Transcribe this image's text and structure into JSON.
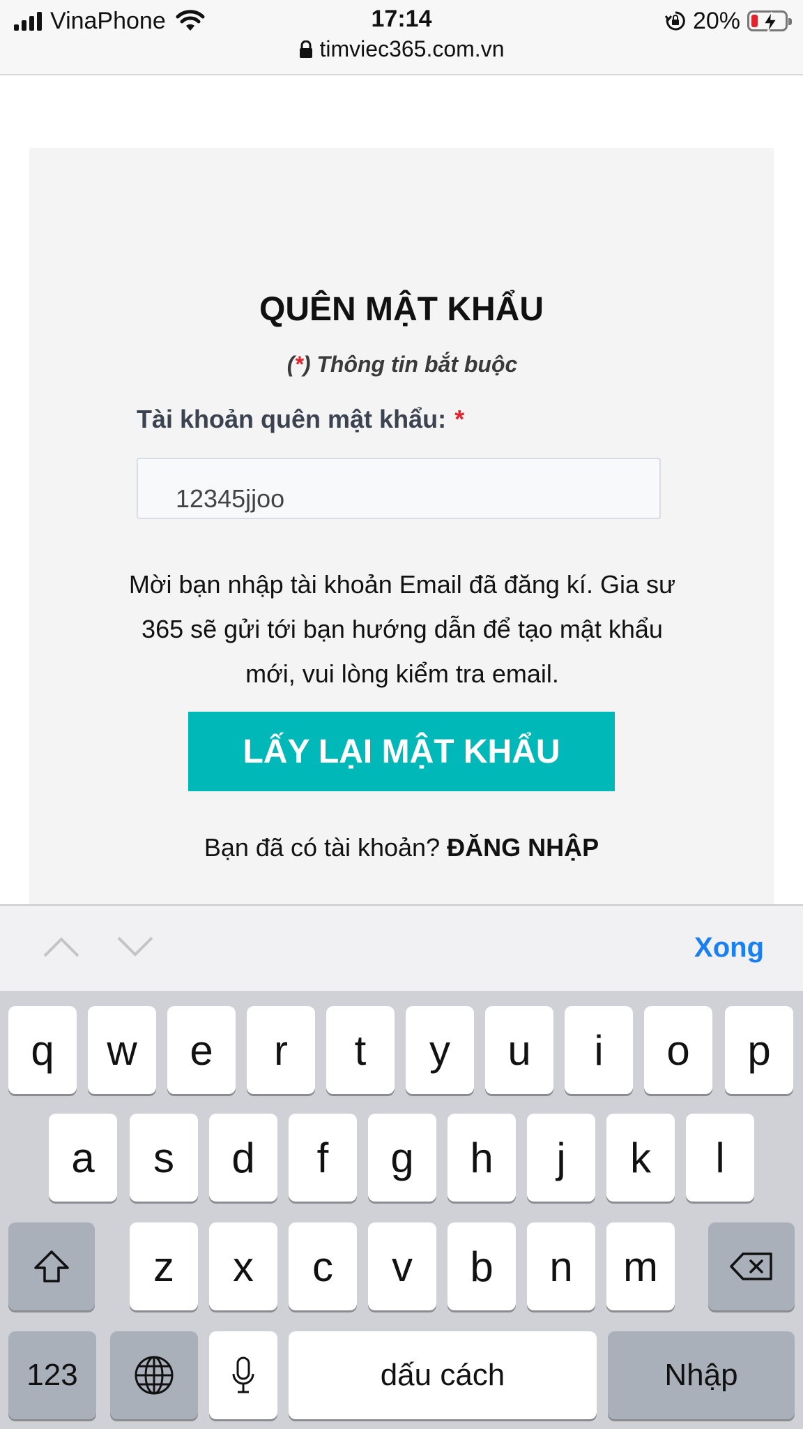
{
  "status_bar": {
    "carrier": "VinaPhone",
    "time": "17:14",
    "battery_percent": "20%",
    "battery_level": 0.2,
    "url": "timviec365.com.vn"
  },
  "form": {
    "title": "QUÊN MẬT KHẨU",
    "required_prefix": "(",
    "required_star": "*",
    "required_suffix": ") Thông tin bắt buộc",
    "field_label": "Tài khoản quên mật khẩu:",
    "field_star": "*",
    "input_value": "12345jjoo",
    "help_text": "Mời bạn nhập tài khoản Email đã đăng kí. Gia sư 365 sẽ gửi tới bạn hướng dẫn để tạo mật khẩu mới, vui lòng kiểm tra email.",
    "submit_label": "LẤY LẠI MẬT KHẨU",
    "login_prompt": "Bạn đã có tài khoản?",
    "login_link": "ĐĂNG NHẬP"
  },
  "accessory": {
    "done_label": "Xong"
  },
  "keyboard": {
    "row1": [
      "q",
      "w",
      "e",
      "r",
      "t",
      "y",
      "u",
      "i",
      "o",
      "p"
    ],
    "row2": [
      "a",
      "s",
      "d",
      "f",
      "g",
      "h",
      "j",
      "k",
      "l"
    ],
    "row3": [
      "z",
      "x",
      "c",
      "v",
      "b",
      "n",
      "m"
    ],
    "numbers_label": "123",
    "space_label": "dấu cách",
    "return_label": "Nhập",
    "shift_icon": "shift-icon",
    "delete_icon": "backspace-icon",
    "globe_icon": "globe-icon",
    "mic_icon": "microphone-icon"
  },
  "colors": {
    "accent": "#00b8b8",
    "required": "#e0242c",
    "link_blue": "#1a7ff0"
  }
}
